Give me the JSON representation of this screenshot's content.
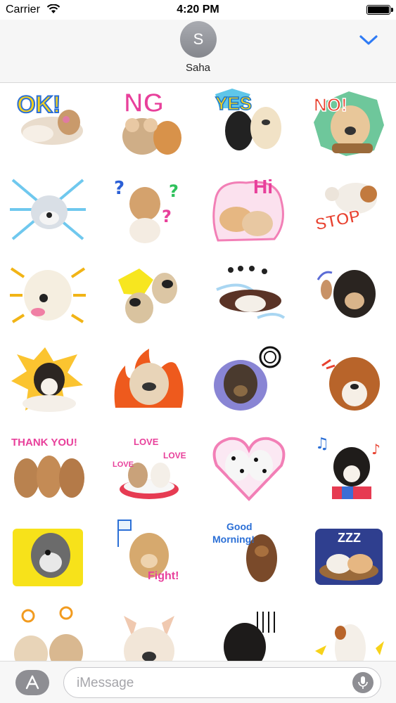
{
  "status_bar": {
    "carrier": "Carrier",
    "time": "4:20 PM",
    "battery_level": 1.0
  },
  "conversation": {
    "contact_initial": "S",
    "contact_name": "Saha",
    "accent_color": "#2f7bf5"
  },
  "stickers": {
    "r1c1": "OK!",
    "r1c2": "NG",
    "r1c3": "YES",
    "r1c4": "NO!",
    "r2c3": "Hi",
    "r2c4": "STOP",
    "r5c1": "THANK YOU!",
    "r5c2_a": "LOVE",
    "r5c2_b": "LOVE",
    "r5c2_c": "LOVE",
    "r6c2": "Fight!",
    "r6c3_a": "Good",
    "r6c3_b": "Morning!",
    "r6c4": "ZZZ"
  },
  "input": {
    "placeholder": "iMessage"
  },
  "icons": {
    "wifi": "wifi-icon",
    "battery": "battery-icon",
    "collapse": "chevron-down-icon",
    "app_store": "app-store-icon",
    "microphone": "microphone-icon"
  }
}
